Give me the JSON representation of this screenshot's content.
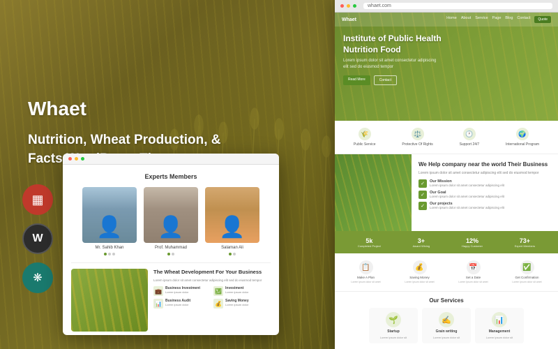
{
  "theme": {
    "name": "Whaet",
    "tagline": "Nutrition, Wheat Production, & Facts WordPress Theme",
    "accentColor": "#7a9a35",
    "bgColorLeft": "#7a7025"
  },
  "website_preview": {
    "nav": {
      "logo": "Whaet",
      "links": [
        "Home",
        "About",
        "Service",
        "Page",
        "Blog",
        "Contact"
      ],
      "cta": "Quote"
    },
    "hero": {
      "title": "Institute of Public Health Nutrition Food",
      "subtitle": "Lorem ipsum dolor sit amet consectetur adipiscing elit sed do eiusmod tempor",
      "btn1": "Read More",
      "btn2": "Contact"
    },
    "features": [
      {
        "icon": "🌾",
        "label": "Public Service"
      },
      {
        "icon": "⚖️",
        "label": "Protective Of Rights"
      },
      {
        "icon": "🕐",
        "label": "Support 24/7"
      },
      {
        "icon": "🌍",
        "label": "International Program"
      }
    ],
    "mid": {
      "title": "We Help company near the world Their Business",
      "text": "Lorem ipsum dolor sit amet consectetur adipiscing elit sed do eiusmod tempor",
      "missions": [
        {
          "label": "Our Mission",
          "desc": "Lorem ipsum dolor sit amet consectetur adipiscing elit"
        },
        {
          "label": "Our Goal",
          "desc": "Lorem ipsum dolor sit amet consectetur adipiscing elit"
        },
        {
          "label": "Our projects",
          "desc": "Lorem ipsum dolor sit amet consectetur adipiscing elit"
        }
      ]
    },
    "stats": [
      {
        "num": "5k",
        "label": "Completed Project"
      },
      {
        "num": "3+",
        "label": "Award Wining"
      },
      {
        "num": "12%",
        "label": "Happy Customer"
      },
      {
        "num": "73+",
        "label": "Expert Members"
      }
    ],
    "steps": [
      {
        "icon": "📋",
        "label": "Make A Plan",
        "desc": "Lorem ipsum dolor sit amet"
      },
      {
        "icon": "💰",
        "label": "Saving Money",
        "desc": "Lorem ipsum dolor sit amet"
      },
      {
        "icon": "📅",
        "label": "Set a Date",
        "desc": "Lorem ipsum dolor sit amet"
      },
      {
        "icon": "✅",
        "label": "Get Confirmation",
        "desc": "Lorem ipsum dolor sit amet"
      }
    ],
    "services": {
      "title": "Our Services",
      "items": [
        {
          "icon": "🌱",
          "name": "Startup",
          "desc": "Lorem ipsum dolor sit"
        },
        {
          "icon": "✍️",
          "name": "Grain writing",
          "desc": "Lorem ipsum dolor sit"
        },
        {
          "icon": "📊",
          "name": "Management",
          "desc": "Lorem ipsum dolor sit"
        }
      ]
    }
  },
  "left_mockup": {
    "experts_title": "Experts Members",
    "experts": [
      {
        "name": "Mr. Sahib Khan",
        "photo_class": "expert-photo-1"
      },
      {
        "name": "Prof. Muhammad",
        "photo_class": "expert-photo-2"
      },
      {
        "name": "Salaman Ali",
        "photo_class": "expert-photo-3"
      }
    ],
    "wheat_section": {
      "title": "The Wheat Development For Your Business",
      "text": "Lorem ipsum dolor sit amet consectetur adipiscing elit sed do eiusmod tempor",
      "features": [
        {
          "icon": "💼",
          "label": "Business Investment",
          "desc": "Lorem ipsum dolor"
        },
        {
          "icon": "💹",
          "label": "Investment",
          "desc": "Lorem ipsum dolor"
        },
        {
          "icon": "📊",
          "label": "Business Audit",
          "desc": "Lorem ipsum dolor"
        },
        {
          "icon": "💰",
          "label": "Saving Money",
          "desc": "Lorem ipsum dolor"
        }
      ]
    }
  },
  "social_icons": [
    {
      "name": "menubar-icon",
      "color": "red",
      "symbol": "▦"
    },
    {
      "name": "wordpress-icon",
      "color": "dark",
      "symbol": "W"
    },
    {
      "name": "envato-icon",
      "color": "teal",
      "symbol": "❋"
    }
  ]
}
